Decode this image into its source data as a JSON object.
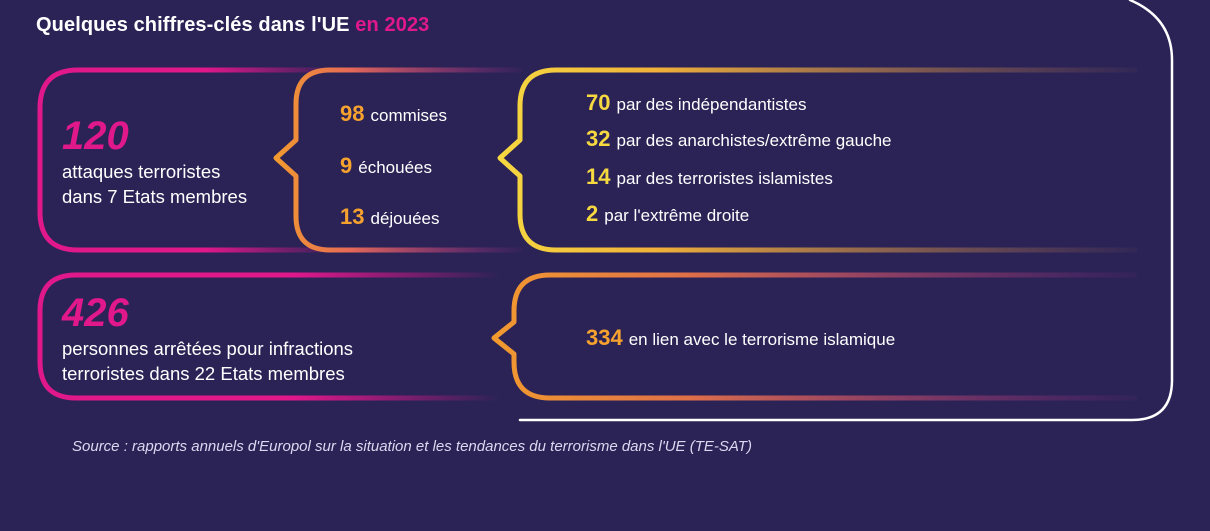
{
  "header": {
    "title_main": "Quelques chiffres-clés dans l'UE",
    "title_highlight": "en 2023",
    "highlight_color": "#e0188a"
  },
  "attacks": {
    "total_number": "120",
    "description_line1": "attaques terroristes",
    "description_line2": "dans 7 Etats membres",
    "breakdown": [
      {
        "number": "98",
        "label": "commises"
      },
      {
        "number": "9",
        "label": "échouées"
      },
      {
        "number": "13",
        "label": "déjouées"
      }
    ],
    "perpetrators": [
      {
        "number": "70",
        "label": "par des indépendantistes"
      },
      {
        "number": "32",
        "label": "par des anarchistes/extrême gauche"
      },
      {
        "number": "14",
        "label": "par des terroristes islamistes"
      },
      {
        "number": "2",
        "label": "par l'extrême droite"
      }
    ]
  },
  "arrests": {
    "total_number": "426",
    "description_line1": "personnes arrêtées pour infractions",
    "description_line2": "terroristes dans 22 Etats membres",
    "detail_number": "334",
    "detail_label": "en lien avec le terrorisme islamique"
  },
  "footer": {
    "source": "Source : rapports annuels d'Europol sur la situation et les tendances du terrorisme dans l'UE (TE-SAT)"
  },
  "colors": {
    "background": "#2b2356",
    "magenta": "#e0188a",
    "orange": "#f7a22e",
    "yellow": "#f6d840"
  }
}
